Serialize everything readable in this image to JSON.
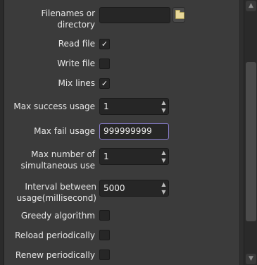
{
  "settings": {
    "filenames_label_line1": "Filenames or",
    "filenames_label_line2": "directory",
    "filenames_value": "",
    "read_file_label": "Read file",
    "read_file_checked": true,
    "write_file_label": "Write file",
    "write_file_checked": false,
    "mix_lines_label": "Mix lines",
    "mix_lines_checked": true,
    "max_success_label": "Max success usage",
    "max_success_value": "1",
    "max_fail_label": "Max fail usage",
    "max_fail_value": "999999999",
    "max_simul_label_line1": "Max number of",
    "max_simul_label_line2": "simultaneous use",
    "max_simul_value": "1",
    "interval_label_line1": "Interval between",
    "interval_label_line2": "usage(millisecond)",
    "interval_value": "5000",
    "greedy_label": "Greedy algorithm",
    "greedy_checked": false,
    "reload_label": "Reload periodically",
    "reload_checked": false,
    "renew_label": "Renew periodically",
    "renew_checked": false
  },
  "icons": {
    "checkmark": "✓",
    "spin_up": "▲",
    "spin_down": "▼"
  },
  "colors": {
    "background": "#3b3b3b",
    "field_bg": "#262626",
    "focus_border": "#8b7fd1"
  }
}
